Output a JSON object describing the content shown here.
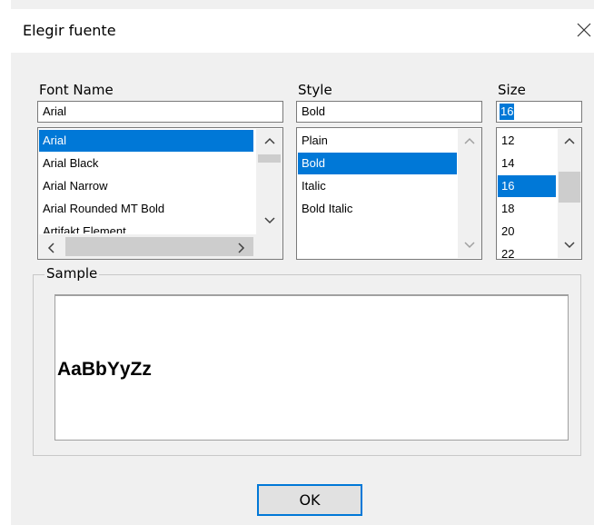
{
  "window": {
    "title": "Elegir fuente"
  },
  "font_name": {
    "label": "Font Name",
    "value": "Arial",
    "items": [
      "Arial",
      "Arial Black",
      "Arial Narrow",
      "Arial Rounded MT Bold",
      "Artifakt Element"
    ],
    "selected": "Arial"
  },
  "style": {
    "label": "Style",
    "value": "Bold",
    "items": [
      "Plain",
      "Bold",
      "Italic",
      "Bold Italic"
    ],
    "selected": "Bold"
  },
  "size": {
    "label": "Size",
    "value": "16",
    "items": [
      "12",
      "14",
      "16",
      "18",
      "20",
      "22"
    ],
    "selected": "16"
  },
  "sample": {
    "label": "Sample",
    "text": "AaBbYyZz"
  },
  "buttons": {
    "ok": "OK"
  },
  "icons": {
    "close": "close-icon",
    "up": "chevron-up-icon",
    "down": "chevron-down-icon",
    "left": "chevron-left-icon",
    "right": "chevron-right-icon"
  },
  "colors": {
    "selection": "#0078d7",
    "dialog_bg": "#f0f0f0"
  }
}
